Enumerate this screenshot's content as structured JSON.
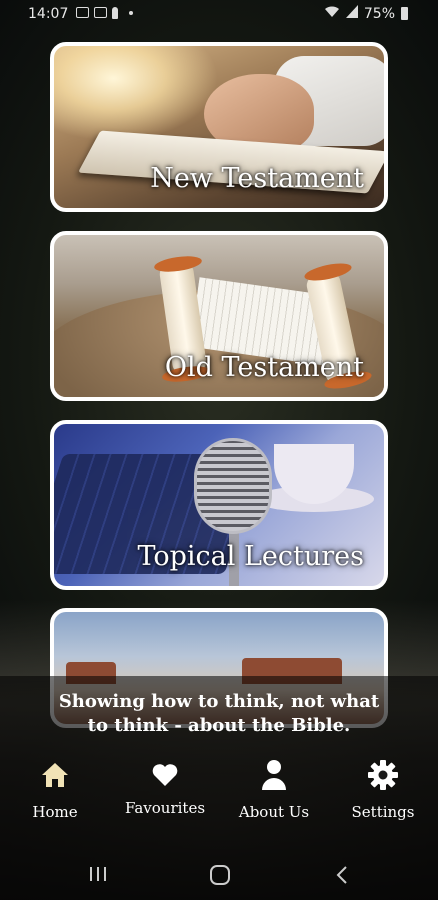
{
  "status_bar": {
    "time": "14:07",
    "battery": "75%",
    "notification_icons": [
      "sim-icon",
      "youtube-icon",
      "pin-icon",
      "dot-icon"
    ],
    "right_icons": [
      "wifi-icon",
      "signal-icon",
      "battery-icon"
    ]
  },
  "cards": [
    {
      "title": "New Testament"
    },
    {
      "title": "Old Testament"
    },
    {
      "title": "Topical Lectures"
    },
    {
      "title": ""
    }
  ],
  "tagline": {
    "line1": "Showing how to think, not what",
    "line2": "to think - about the Bible."
  },
  "nav": {
    "items": [
      {
        "label": "Home",
        "icon": "home-icon"
      },
      {
        "label": "Favourites",
        "icon": "heart-icon"
      },
      {
        "label": "About Us",
        "icon": "person-icon"
      },
      {
        "label": "Settings",
        "icon": "gear-icon"
      }
    ]
  },
  "system_nav": {
    "icons": [
      "recent-apps-icon",
      "home-circle-icon",
      "back-icon"
    ]
  },
  "colors": {
    "accent": "#ffffff",
    "nav_icon_home": "#f1e3b6",
    "card_border": "#ffffff",
    "background": "#141812"
  }
}
